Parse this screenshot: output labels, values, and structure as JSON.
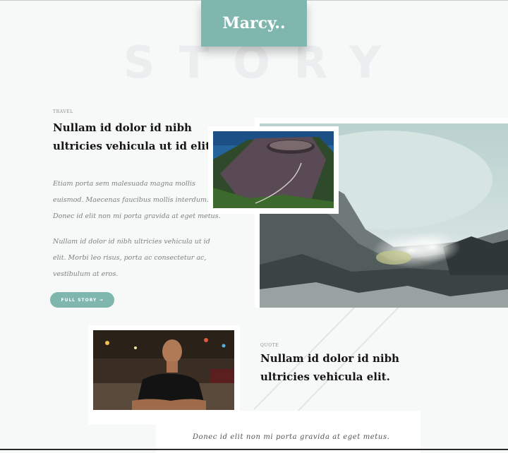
{
  "brand": {
    "logo": "Marcy..",
    "watermark": "STORY"
  },
  "story1": {
    "category": "TRAVEL",
    "title_line1": "Nullam id dolor id nibh",
    "title_line2": "ultricies vehicula ut id elit.",
    "p1_line1": "Etiam porta sem malesuada magna mollis",
    "p1_line2": "euismod. Maecenas faucibus mollis interdum.",
    "p1_line3": "Donec id elit non mi porta gravida at eget metus.",
    "p2_line1": "Nullam id dolor id nibh ultricies vehicula ut id",
    "p2_line2": "elit. Morbi leo risus, porta ac consectetur ac,",
    "p2_line3": "vestibulum at eros.",
    "button": "FULL STORY →"
  },
  "story2": {
    "category": "QUOTE",
    "title_line1": "Nullam id dolor id nibh",
    "title_line2": "ultricies vehicula elit.",
    "quote": "Donec id elit non mi porta gravida at eget metus."
  },
  "colors": {
    "accent": "#7fb6ae",
    "background": "#f7f8f8"
  },
  "images": {
    "large": "volcano-steam-photo",
    "small": "volcano-crater-photo",
    "person": "man-at-night-photo"
  }
}
